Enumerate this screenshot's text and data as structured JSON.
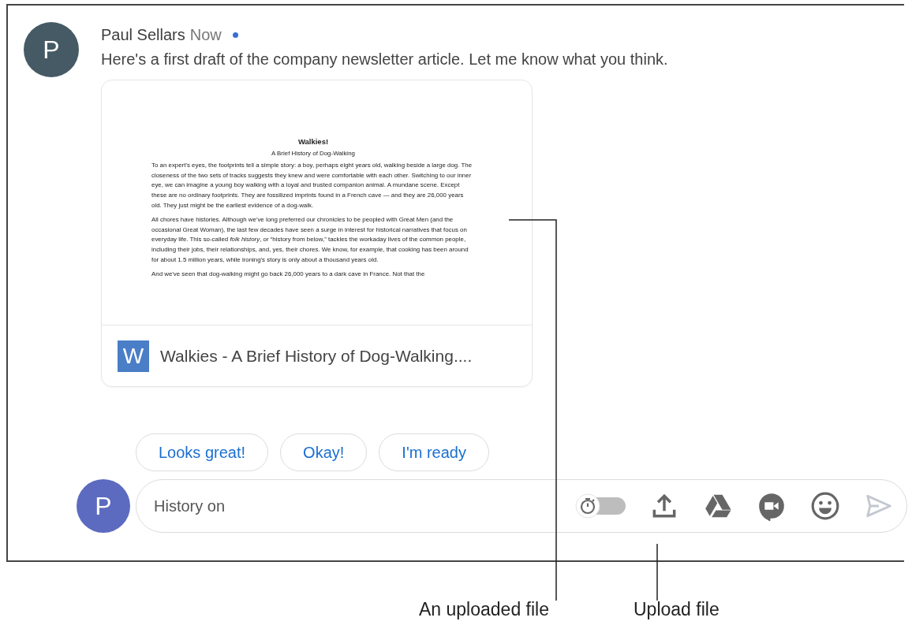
{
  "message": {
    "avatar_letter": "P",
    "sender": "Paul Sellars",
    "time": "Now",
    "unread": true,
    "text": "Here's a first draft of the company newsletter article. Let me know what you think."
  },
  "attachment": {
    "preview": {
      "title": "Walkies!",
      "subtitle": "A Brief History of Dog-Walking",
      "paragraphs": [
        "To an expert's eyes, the footprints tell a simple story: a boy, perhaps eight years old, walking beside a large dog. The closeness of the two sets of tracks suggests they knew and were comfortable with each other. Switching to our inner eye, we can imagine a young boy walking with a loyal and trusted companion animal. A mundane scene. Except these are no ordinary footprints. They are fossilized imprints found in a French cave — and they are 26,000 years old. They just might be the earliest evidence of a dog-walk.",
        "All chores have histories. Although we've long preferred our chronicles to be peopled with Great Men (and the occasional Great Woman), the last few decades have seen a surge in interest for historical narratives that focus on everyday life. This so-called *folk history*, or “history from below,” tackles the workaday lives of the common people, including their jobs, their relationships, and, yes, their chores. We know, for example, that cooking has been around for about 1.5 million years, while ironing's story is only about a thousand years old.",
        "And we've seen that dog-walking might go back 26,000 years to a dark cave in France. Not that the"
      ]
    },
    "file_icon_letter": "W",
    "file_name": "Walkies - A Brief History of Dog-Walking...."
  },
  "smart_replies": [
    "Looks great!",
    "Okay!",
    "I'm ready"
  ],
  "compose": {
    "avatar_letter": "P",
    "value": "History on",
    "history_on": false,
    "send_disabled": true
  },
  "callouts": [
    {
      "label": "An uploaded file"
    },
    {
      "label": "Upload file"
    }
  ]
}
